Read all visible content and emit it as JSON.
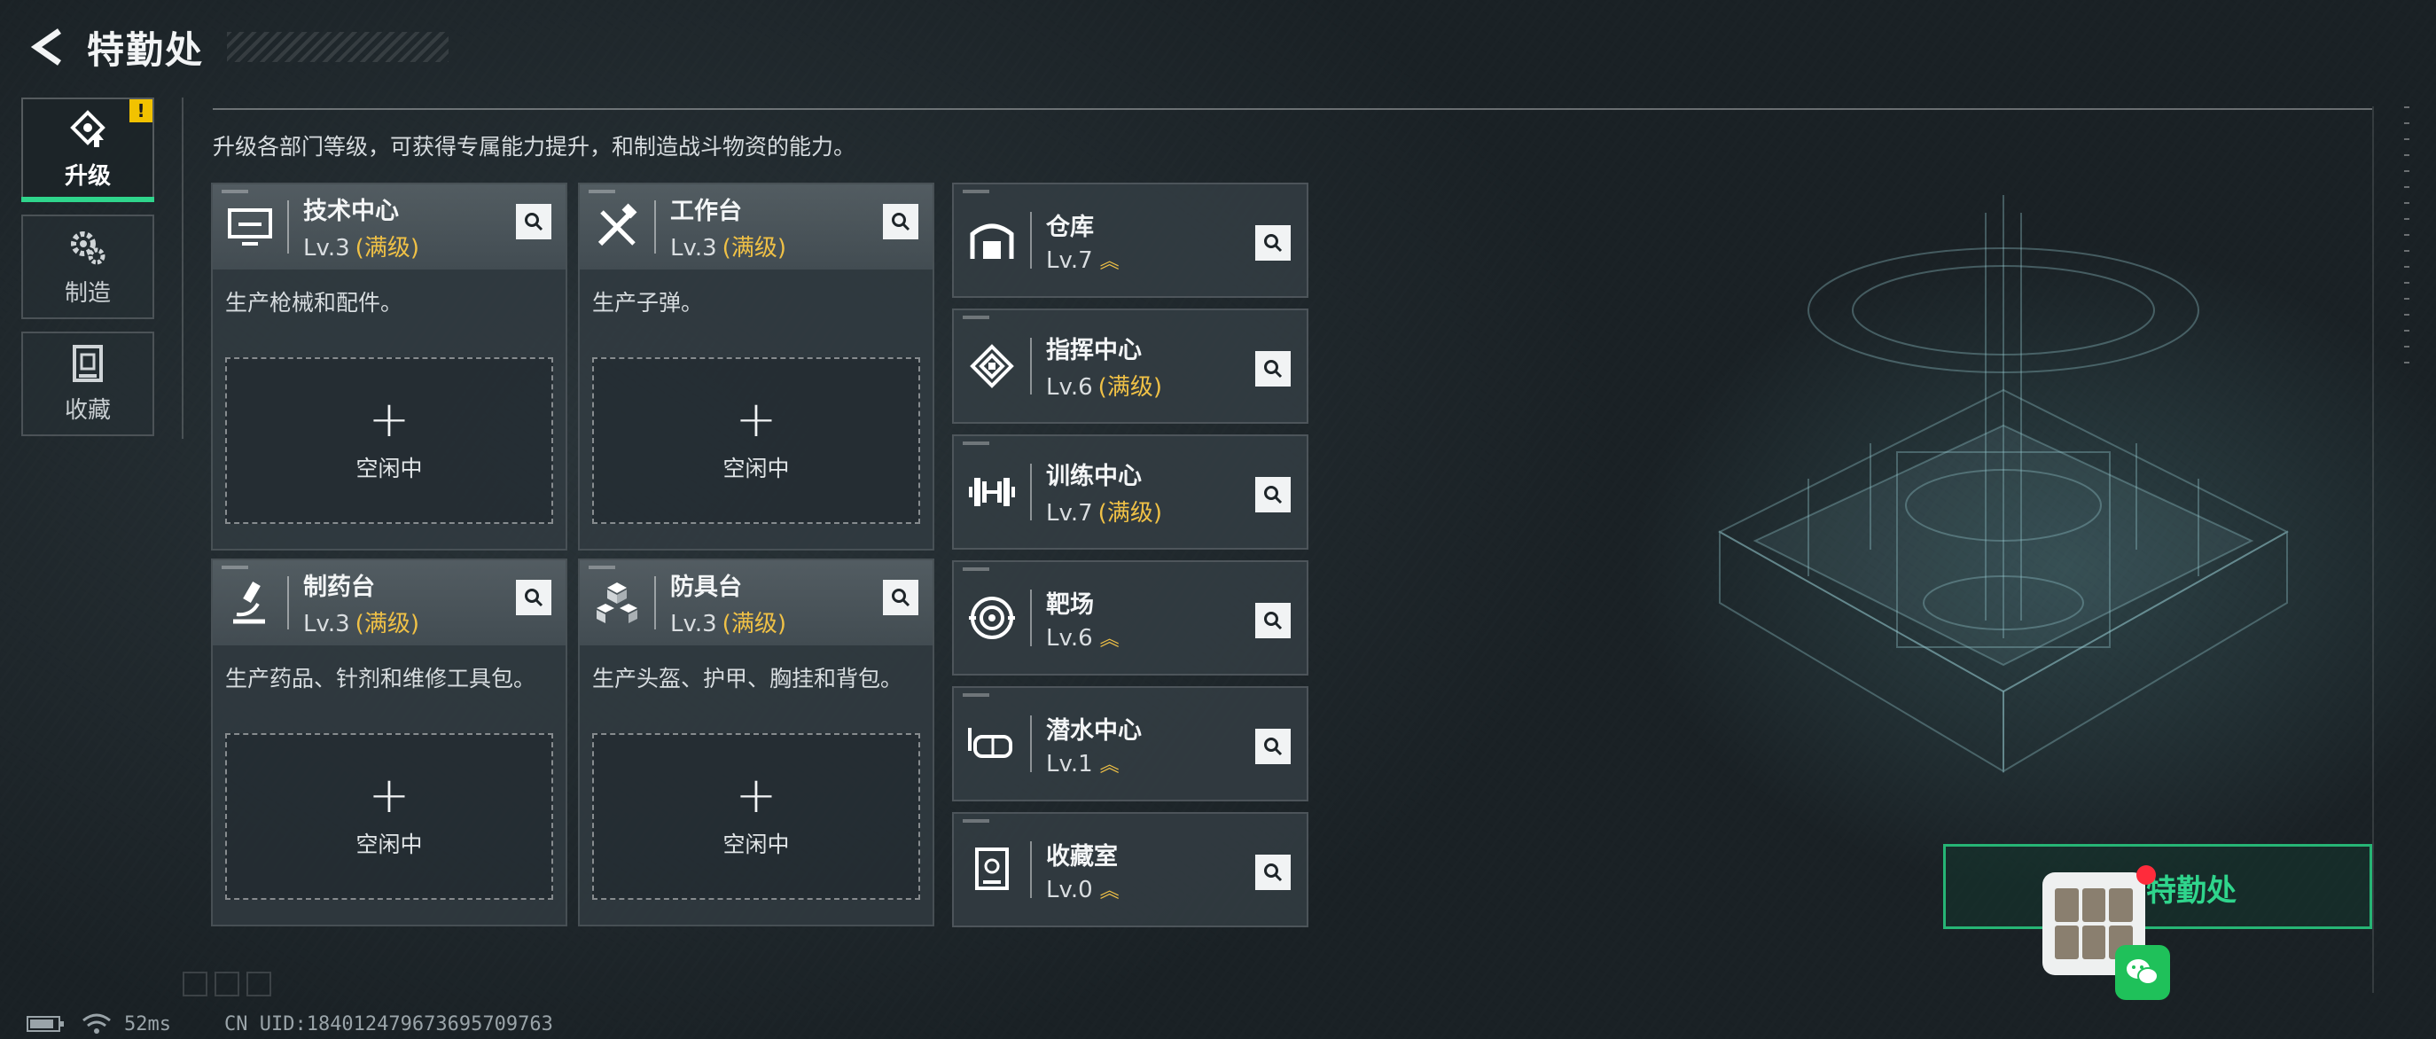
{
  "header": {
    "title": "特勤处"
  },
  "side_tabs": [
    {
      "label": "升级",
      "active": true,
      "warning": "!"
    },
    {
      "label": "制造",
      "active": false
    },
    {
      "label": "收藏",
      "active": false
    }
  ],
  "description": "升级各部门等级，可获得专属能力提升，和制造战斗物资的能力。",
  "workshops": [
    {
      "name": "技术中心",
      "level": "Lv.3",
      "status": "(满级)",
      "desc": "生产枪械和配件。",
      "slot_plus": "+",
      "slot_label": "空闲中"
    },
    {
      "name": "工作台",
      "level": "Lv.3",
      "status": "(满级)",
      "desc": "生产子弹。",
      "slot_plus": "+",
      "slot_label": "空闲中"
    },
    {
      "name": "制药台",
      "level": "Lv.3",
      "status": "(满级)",
      "desc": "生产药品、针剂和维修工具包。",
      "slot_plus": "+",
      "slot_label": "空闲中"
    },
    {
      "name": "防具台",
      "level": "Lv.3",
      "status": "(满级)",
      "desc": "生产头盔、护甲、胸挂和背包。",
      "slot_plus": "+",
      "slot_label": "空闲中"
    }
  ],
  "facilities": [
    {
      "name": "仓库",
      "level": "Lv.7",
      "status": "",
      "upgradable": true
    },
    {
      "name": "指挥中心",
      "level": "Lv.6",
      "status": "(满级)",
      "upgradable": false
    },
    {
      "name": "训练中心",
      "level": "Lv.7",
      "status": "(满级)",
      "upgradable": false
    },
    {
      "name": "靶场",
      "level": "Lv.6",
      "status": "",
      "upgradable": true
    },
    {
      "name": "潜水中心",
      "level": "Lv.1",
      "status": "",
      "upgradable": true
    },
    {
      "name": "收藏室",
      "level": "Lv.0",
      "status": "",
      "upgradable": true
    }
  ],
  "hud_button": {
    "label": "特勤处"
  },
  "status": {
    "ping": "52ms",
    "uid": "CN UID:1840124796736957097​63"
  },
  "colors": {
    "accent_green": "#2fd58c",
    "maxed_gold": "#f0c146",
    "warning_yellow": "#f2c200"
  }
}
